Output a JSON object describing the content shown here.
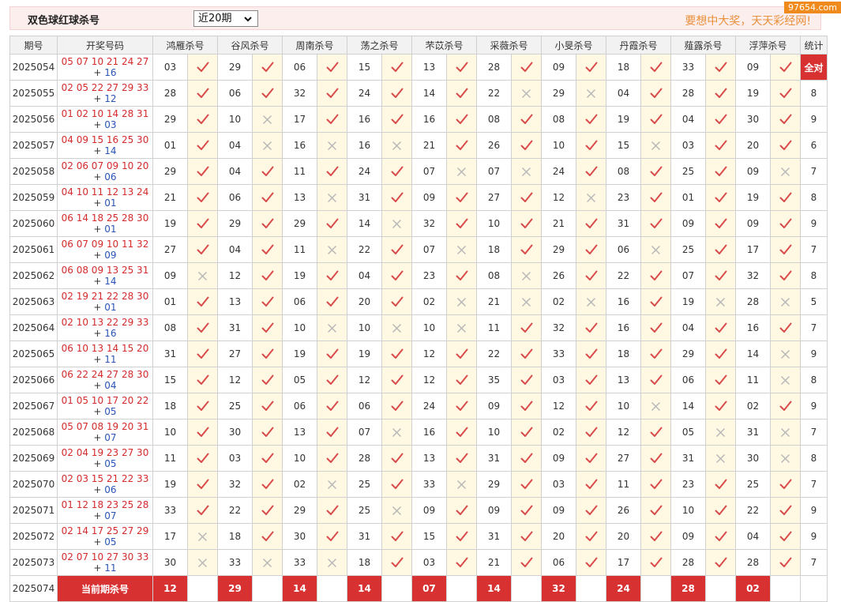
{
  "title": "双色球红球杀号",
  "period_select": "近20期",
  "slogan": "要想中大奖，天天彩经网!",
  "watermark": "97654.com",
  "headers": [
    "期号",
    "开奖号码",
    "鸿雁杀号",
    "谷风杀号",
    "周南杀号",
    "荡之杀号",
    "芣苡杀号",
    "采薇杀号",
    "小旻杀号",
    "丹霞杀号",
    "薤露杀号",
    "浮萍杀号",
    "统计"
  ],
  "rows": [
    {
      "issue": "2025054",
      "reds": "05 07 10 21 24 27",
      "blue": "16",
      "picks": [
        [
          "03",
          1
        ],
        [
          "29",
          1
        ],
        [
          "06",
          1
        ],
        [
          "15",
          1
        ],
        [
          "13",
          1
        ],
        [
          "28",
          1
        ],
        [
          "09",
          1
        ],
        [
          "18",
          1
        ],
        [
          "33",
          1
        ],
        [
          "09",
          1
        ]
      ],
      "count": "全对"
    },
    {
      "issue": "2025055",
      "reds": "02 05 22 27 29 33",
      "blue": "12",
      "picks": [
        [
          "28",
          1
        ],
        [
          "06",
          1
        ],
        [
          "32",
          1
        ],
        [
          "24",
          1
        ],
        [
          "14",
          1
        ],
        [
          "22",
          0
        ],
        [
          "29",
          0
        ],
        [
          "04",
          1
        ],
        [
          "28",
          1
        ],
        [
          "19",
          1
        ]
      ],
      "count": "8"
    },
    {
      "issue": "2025056",
      "reds": "01 02 10 14 28 31",
      "blue": "03",
      "picks": [
        [
          "29",
          1
        ],
        [
          "10",
          0
        ],
        [
          "17",
          1
        ],
        [
          "16",
          1
        ],
        [
          "16",
          1
        ],
        [
          "08",
          1
        ],
        [
          "08",
          1
        ],
        [
          "19",
          1
        ],
        [
          "04",
          1
        ],
        [
          "30",
          1
        ]
      ],
      "count": "9"
    },
    {
      "issue": "2025057",
      "reds": "04 09 15 16 25 30",
      "blue": "14",
      "picks": [
        [
          "01",
          1
        ],
        [
          "04",
          0
        ],
        [
          "16",
          0
        ],
        [
          "16",
          0
        ],
        [
          "21",
          1
        ],
        [
          "26",
          1
        ],
        [
          "10",
          1
        ],
        [
          "15",
          0
        ],
        [
          "03",
          1
        ],
        [
          "20",
          1
        ]
      ],
      "count": "6"
    },
    {
      "issue": "2025058",
      "reds": "02 06 07 09 10 20",
      "blue": "06",
      "picks": [
        [
          "29",
          1
        ],
        [
          "04",
          1
        ],
        [
          "11",
          1
        ],
        [
          "24",
          1
        ],
        [
          "07",
          0
        ],
        [
          "07",
          0
        ],
        [
          "24",
          1
        ],
        [
          "08",
          1
        ],
        [
          "25",
          1
        ],
        [
          "09",
          0
        ]
      ],
      "count": "7"
    },
    {
      "issue": "2025059",
      "reds": "04 10 11 12 13 24",
      "blue": "01",
      "picks": [
        [
          "21",
          1
        ],
        [
          "06",
          1
        ],
        [
          "13",
          0
        ],
        [
          "31",
          1
        ],
        [
          "09",
          1
        ],
        [
          "27",
          1
        ],
        [
          "12",
          0
        ],
        [
          "23",
          1
        ],
        [
          "01",
          1
        ],
        [
          "19",
          1
        ]
      ],
      "count": "8"
    },
    {
      "issue": "2025060",
      "reds": "06 14 18 25 28 30",
      "blue": "01",
      "picks": [
        [
          "19",
          1
        ],
        [
          "29",
          1
        ],
        [
          "29",
          1
        ],
        [
          "14",
          0
        ],
        [
          "32",
          1
        ],
        [
          "10",
          1
        ],
        [
          "21",
          1
        ],
        [
          "31",
          1
        ],
        [
          "09",
          1
        ],
        [
          "09",
          1
        ]
      ],
      "count": "9"
    },
    {
      "issue": "2025061",
      "reds": "06 07 09 10 11 32",
      "blue": "09",
      "picks": [
        [
          "27",
          1
        ],
        [
          "04",
          1
        ],
        [
          "11",
          0
        ],
        [
          "22",
          1
        ],
        [
          "07",
          0
        ],
        [
          "18",
          1
        ],
        [
          "29",
          1
        ],
        [
          "06",
          0
        ],
        [
          "25",
          1
        ],
        [
          "17",
          1
        ]
      ],
      "count": "7"
    },
    {
      "issue": "2025062",
      "reds": "06 08 09 13 25 31",
      "blue": "14",
      "picks": [
        [
          "09",
          0
        ],
        [
          "12",
          1
        ],
        [
          "19",
          1
        ],
        [
          "04",
          1
        ],
        [
          "23",
          1
        ],
        [
          "08",
          0
        ],
        [
          "26",
          1
        ],
        [
          "22",
          1
        ],
        [
          "07",
          1
        ],
        [
          "32",
          1
        ]
      ],
      "count": "8"
    },
    {
      "issue": "2025063",
      "reds": "02 19 21 22 28 30",
      "blue": "01",
      "picks": [
        [
          "01",
          1
        ],
        [
          "13",
          1
        ],
        [
          "06",
          1
        ],
        [
          "20",
          1
        ],
        [
          "02",
          0
        ],
        [
          "21",
          0
        ],
        [
          "02",
          0
        ],
        [
          "16",
          1
        ],
        [
          "19",
          0
        ],
        [
          "28",
          0
        ]
      ],
      "count": "5"
    },
    {
      "issue": "2025064",
      "reds": "02 10 13 22 29 33",
      "blue": "16",
      "picks": [
        [
          "08",
          1
        ],
        [
          "31",
          1
        ],
        [
          "10",
          0
        ],
        [
          "10",
          0
        ],
        [
          "10",
          0
        ],
        [
          "11",
          1
        ],
        [
          "32",
          1
        ],
        [
          "16",
          1
        ],
        [
          "04",
          1
        ],
        [
          "16",
          1
        ]
      ],
      "count": "7"
    },
    {
      "issue": "2025065",
      "reds": "06 10 13 14 15 20",
      "blue": "11",
      "picks": [
        [
          "31",
          1
        ],
        [
          "27",
          1
        ],
        [
          "19",
          1
        ],
        [
          "19",
          1
        ],
        [
          "12",
          1
        ],
        [
          "22",
          1
        ],
        [
          "33",
          1
        ],
        [
          "18",
          1
        ],
        [
          "29",
          1
        ],
        [
          "14",
          0
        ]
      ],
      "count": "9"
    },
    {
      "issue": "2025066",
      "reds": "06 22 24 27 28 30",
      "blue": "04",
      "picks": [
        [
          "15",
          1
        ],
        [
          "12",
          1
        ],
        [
          "05",
          1
        ],
        [
          "12",
          1
        ],
        [
          "12",
          1
        ],
        [
          "35",
          1
        ],
        [
          "03",
          1
        ],
        [
          "13",
          1
        ],
        [
          "06",
          1
        ],
        [
          "11",
          0
        ]
      ],
      "count": "8"
    },
    {
      "issue": "2025067",
      "reds": "01 05 10 17 20 22",
      "blue": "05",
      "picks": [
        [
          "18",
          1
        ],
        [
          "25",
          1
        ],
        [
          "06",
          1
        ],
        [
          "06",
          1
        ],
        [
          "24",
          1
        ],
        [
          "09",
          1
        ],
        [
          "12",
          1
        ],
        [
          "10",
          0
        ],
        [
          "14",
          1
        ],
        [
          "02",
          1
        ]
      ],
      "count": "9"
    },
    {
      "issue": "2025068",
      "reds": "05 07 08 19 20 31",
      "blue": "07",
      "picks": [
        [
          "10",
          1
        ],
        [
          "30",
          1
        ],
        [
          "13",
          1
        ],
        [
          "07",
          0
        ],
        [
          "16",
          1
        ],
        [
          "10",
          1
        ],
        [
          "02",
          1
        ],
        [
          "12",
          1
        ],
        [
          "05",
          0
        ],
        [
          "31",
          0
        ]
      ],
      "count": "7"
    },
    {
      "issue": "2025069",
      "reds": "02 04 19 23 27 30",
      "blue": "05",
      "picks": [
        [
          "11",
          1
        ],
        [
          "03",
          1
        ],
        [
          "10",
          1
        ],
        [
          "28",
          1
        ],
        [
          "13",
          1
        ],
        [
          "31",
          1
        ],
        [
          "09",
          1
        ],
        [
          "27",
          1
        ],
        [
          "31",
          0
        ],
        [
          "30",
          0
        ]
      ],
      "count": "8"
    },
    {
      "issue": "2025070",
      "reds": "02 03 15 21 22 33",
      "blue": "06",
      "picks": [
        [
          "19",
          1
        ],
        [
          "32",
          1
        ],
        [
          "02",
          0
        ],
        [
          "25",
          1
        ],
        [
          "33",
          0
        ],
        [
          "29",
          1
        ],
        [
          "03",
          1
        ],
        [
          "11",
          1
        ],
        [
          "23",
          1
        ],
        [
          "25",
          1
        ]
      ],
      "count": "7"
    },
    {
      "issue": "2025071",
      "reds": "01 12 18 23 25 28",
      "blue": "07",
      "picks": [
        [
          "33",
          1
        ],
        [
          "22",
          1
        ],
        [
          "29",
          1
        ],
        [
          "25",
          0
        ],
        [
          "09",
          1
        ],
        [
          "09",
          1
        ],
        [
          "09",
          1
        ],
        [
          "26",
          1
        ],
        [
          "10",
          1
        ],
        [
          "22",
          1
        ]
      ],
      "count": "9"
    },
    {
      "issue": "2025072",
      "reds": "02 14 17 25 27 29",
      "blue": "05",
      "picks": [
        [
          "17",
          0
        ],
        [
          "18",
          1
        ],
        [
          "30",
          1
        ],
        [
          "31",
          1
        ],
        [
          "15",
          1
        ],
        [
          "31",
          1
        ],
        [
          "20",
          1
        ],
        [
          "20",
          1
        ],
        [
          "09",
          1
        ],
        [
          "04",
          1
        ]
      ],
      "count": "9"
    },
    {
      "issue": "2025073",
      "reds": "02 07 10 27 30 33",
      "blue": "11",
      "picks": [
        [
          "30",
          0
        ],
        [
          "33",
          0
        ],
        [
          "33",
          0
        ],
        [
          "18",
          1
        ],
        [
          "03",
          1
        ],
        [
          "21",
          1
        ],
        [
          "06",
          1
        ],
        [
          "17",
          1
        ],
        [
          "28",
          1
        ],
        [
          "28",
          1
        ]
      ],
      "count": "7"
    }
  ],
  "current": {
    "issue": "2025074",
    "label": "当前期杀号",
    "picks": [
      "12",
      "29",
      "14",
      "14",
      "07",
      "14",
      "32",
      "24",
      "28",
      "02"
    ]
  },
  "colors": {
    "accent_red": "#d73131",
    "check": "#d94a4a",
    "cross": "#b8b8b8",
    "mark_bg": "#fff9e4",
    "header_bg": "#f2f2f2"
  },
  "icons": {
    "hit": "check-icon",
    "miss": "cross-icon"
  }
}
